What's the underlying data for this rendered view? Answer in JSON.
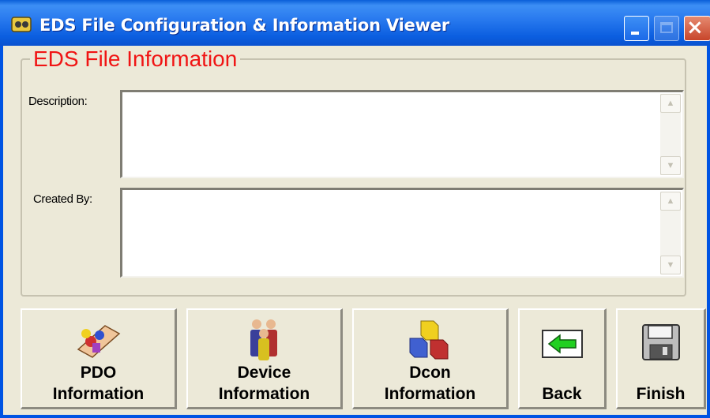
{
  "window": {
    "title": "EDS File Configuration & Information Viewer",
    "close_glyph": "×"
  },
  "eds_info": {
    "legend": "EDS File Information",
    "description_label": "Description:",
    "description_value": "",
    "created_by_label": "Created By:",
    "created_by_value": ""
  },
  "buttons": {
    "pdo": {
      "line1": "PDO",
      "line2": "Information",
      "icon": "pdo-icon"
    },
    "device": {
      "line1": "Device",
      "line2": "Information",
      "icon": "people-icon"
    },
    "dcon": {
      "line1": "Dcon",
      "line2": "Information",
      "icon": "blocks-icon"
    },
    "back": {
      "label": "Back",
      "icon": "arrow-left-icon"
    },
    "finish": {
      "label": "Finish",
      "icon": "floppy-disk-icon"
    }
  },
  "scroll": {
    "up": "▲",
    "down": "▼"
  },
  "colors": {
    "legend_text": "#f01414",
    "titlebar": "#0a5fd8",
    "face": "#ece9d8"
  }
}
